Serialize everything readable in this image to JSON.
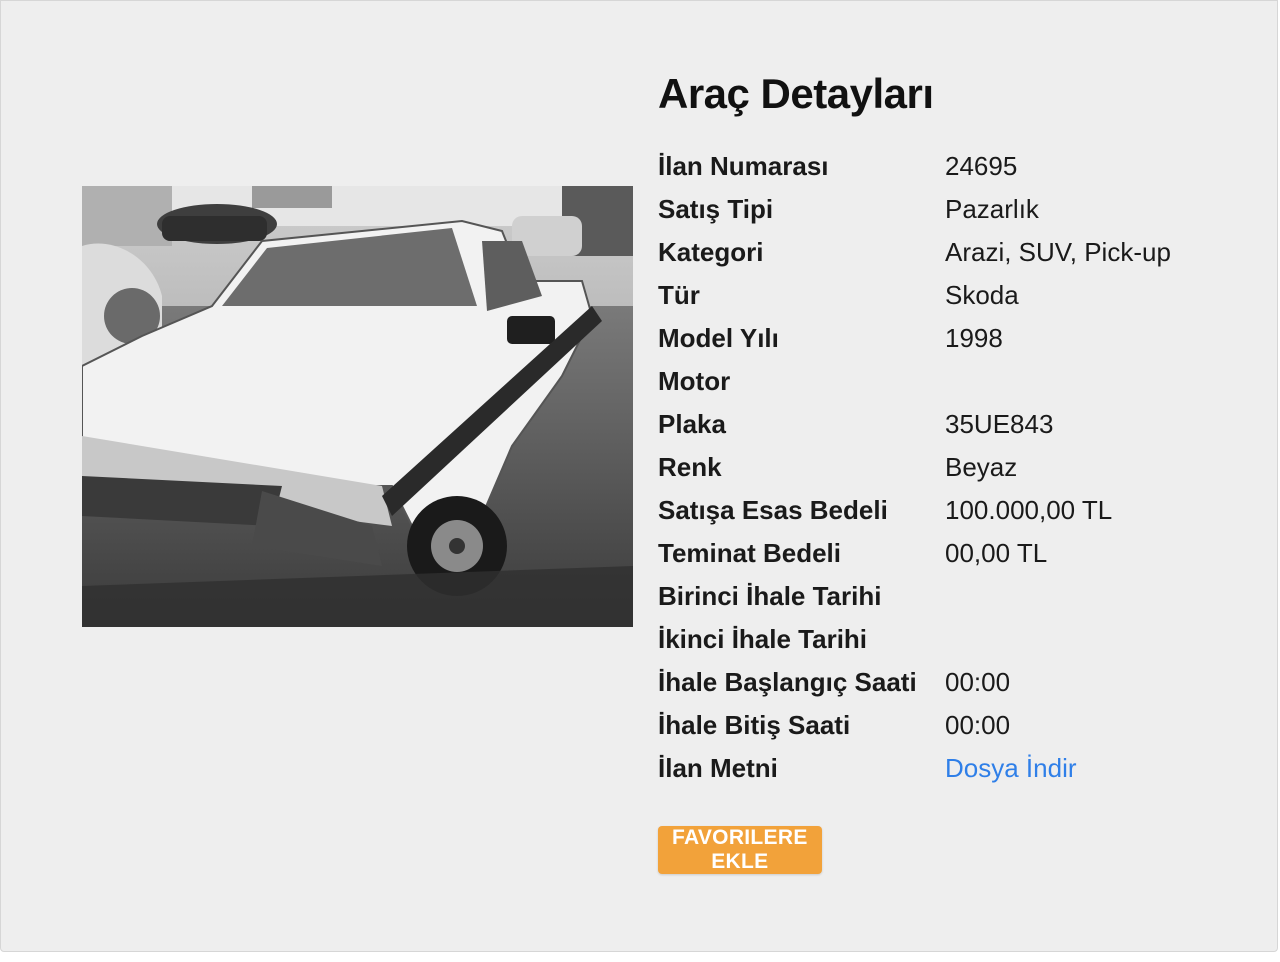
{
  "title": "Araç Detayları",
  "gallery": {
    "image_description": "black and white photo of an old white Skoda pick-up with 'PLAJ BAKANLIĞI' text on the side",
    "slide_count": 3,
    "active_slide": 2
  },
  "details": [
    {
      "label": "İlan Numarası",
      "value": "24695"
    },
    {
      "label": "Satış Tipi",
      "value": "Pazarlık"
    },
    {
      "label": "Kategori",
      "value": "Arazi, SUV, Pick-up"
    },
    {
      "label": "Tür",
      "value": "Skoda"
    },
    {
      "label": "Model Yılı",
      "value": "1998"
    },
    {
      "label": "Motor",
      "value": ""
    },
    {
      "label": "Plaka",
      "value": "35UE843"
    },
    {
      "label": "Renk",
      "value": "Beyaz"
    },
    {
      "label": "Satışa Esas Bedeli",
      "value": "100.000,00 TL"
    },
    {
      "label": "Teminat Bedeli",
      "value": "00,00 TL"
    },
    {
      "label": "Birinci İhale Tarihi",
      "value": ""
    },
    {
      "label": "İkinci İhale Tarihi",
      "value": ""
    },
    {
      "label": "İhale Başlangıç Saati",
      "value": "00:00"
    },
    {
      "label": "İhale Bitiş Saati",
      "value": "00:00"
    },
    {
      "label": "İlan Metni",
      "value": "Dosya İndir"
    }
  ],
  "favorite_button": "FAVORILERE EKLE",
  "colors": {
    "accent": "#f2a23a",
    "link": "#2f7fe8",
    "background": "#eeeeee"
  }
}
